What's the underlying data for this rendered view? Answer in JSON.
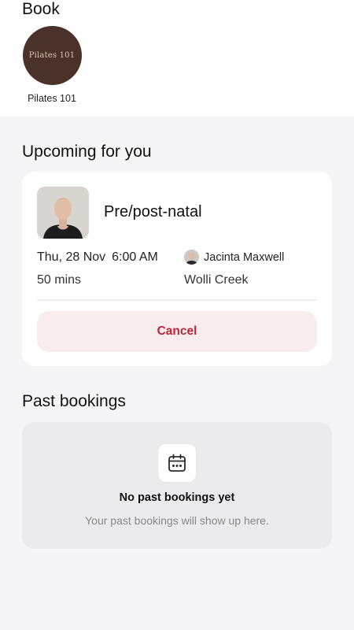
{
  "header": {
    "title": "Book"
  },
  "studio": {
    "logo_text": "Pilates 101",
    "name": "Pilates 101"
  },
  "upcoming": {
    "title": "Upcoming for you",
    "booking": {
      "class_name": "Pre/post-natal",
      "date": "Thu, 28 Nov",
      "time": "6:00 AM",
      "duration": "50 mins",
      "instructor": "Jacinta Maxwell",
      "location": "Wolli Creek",
      "cancel_label": "Cancel"
    }
  },
  "past": {
    "title": "Past bookings",
    "empty_title": "No past bookings yet",
    "empty_subtitle": "Your past bookings will show up here."
  },
  "colors": {
    "cancel_text": "#b8263a",
    "cancel_bg": "#f8ecec",
    "studio_logo_bg": "#4a3129"
  }
}
